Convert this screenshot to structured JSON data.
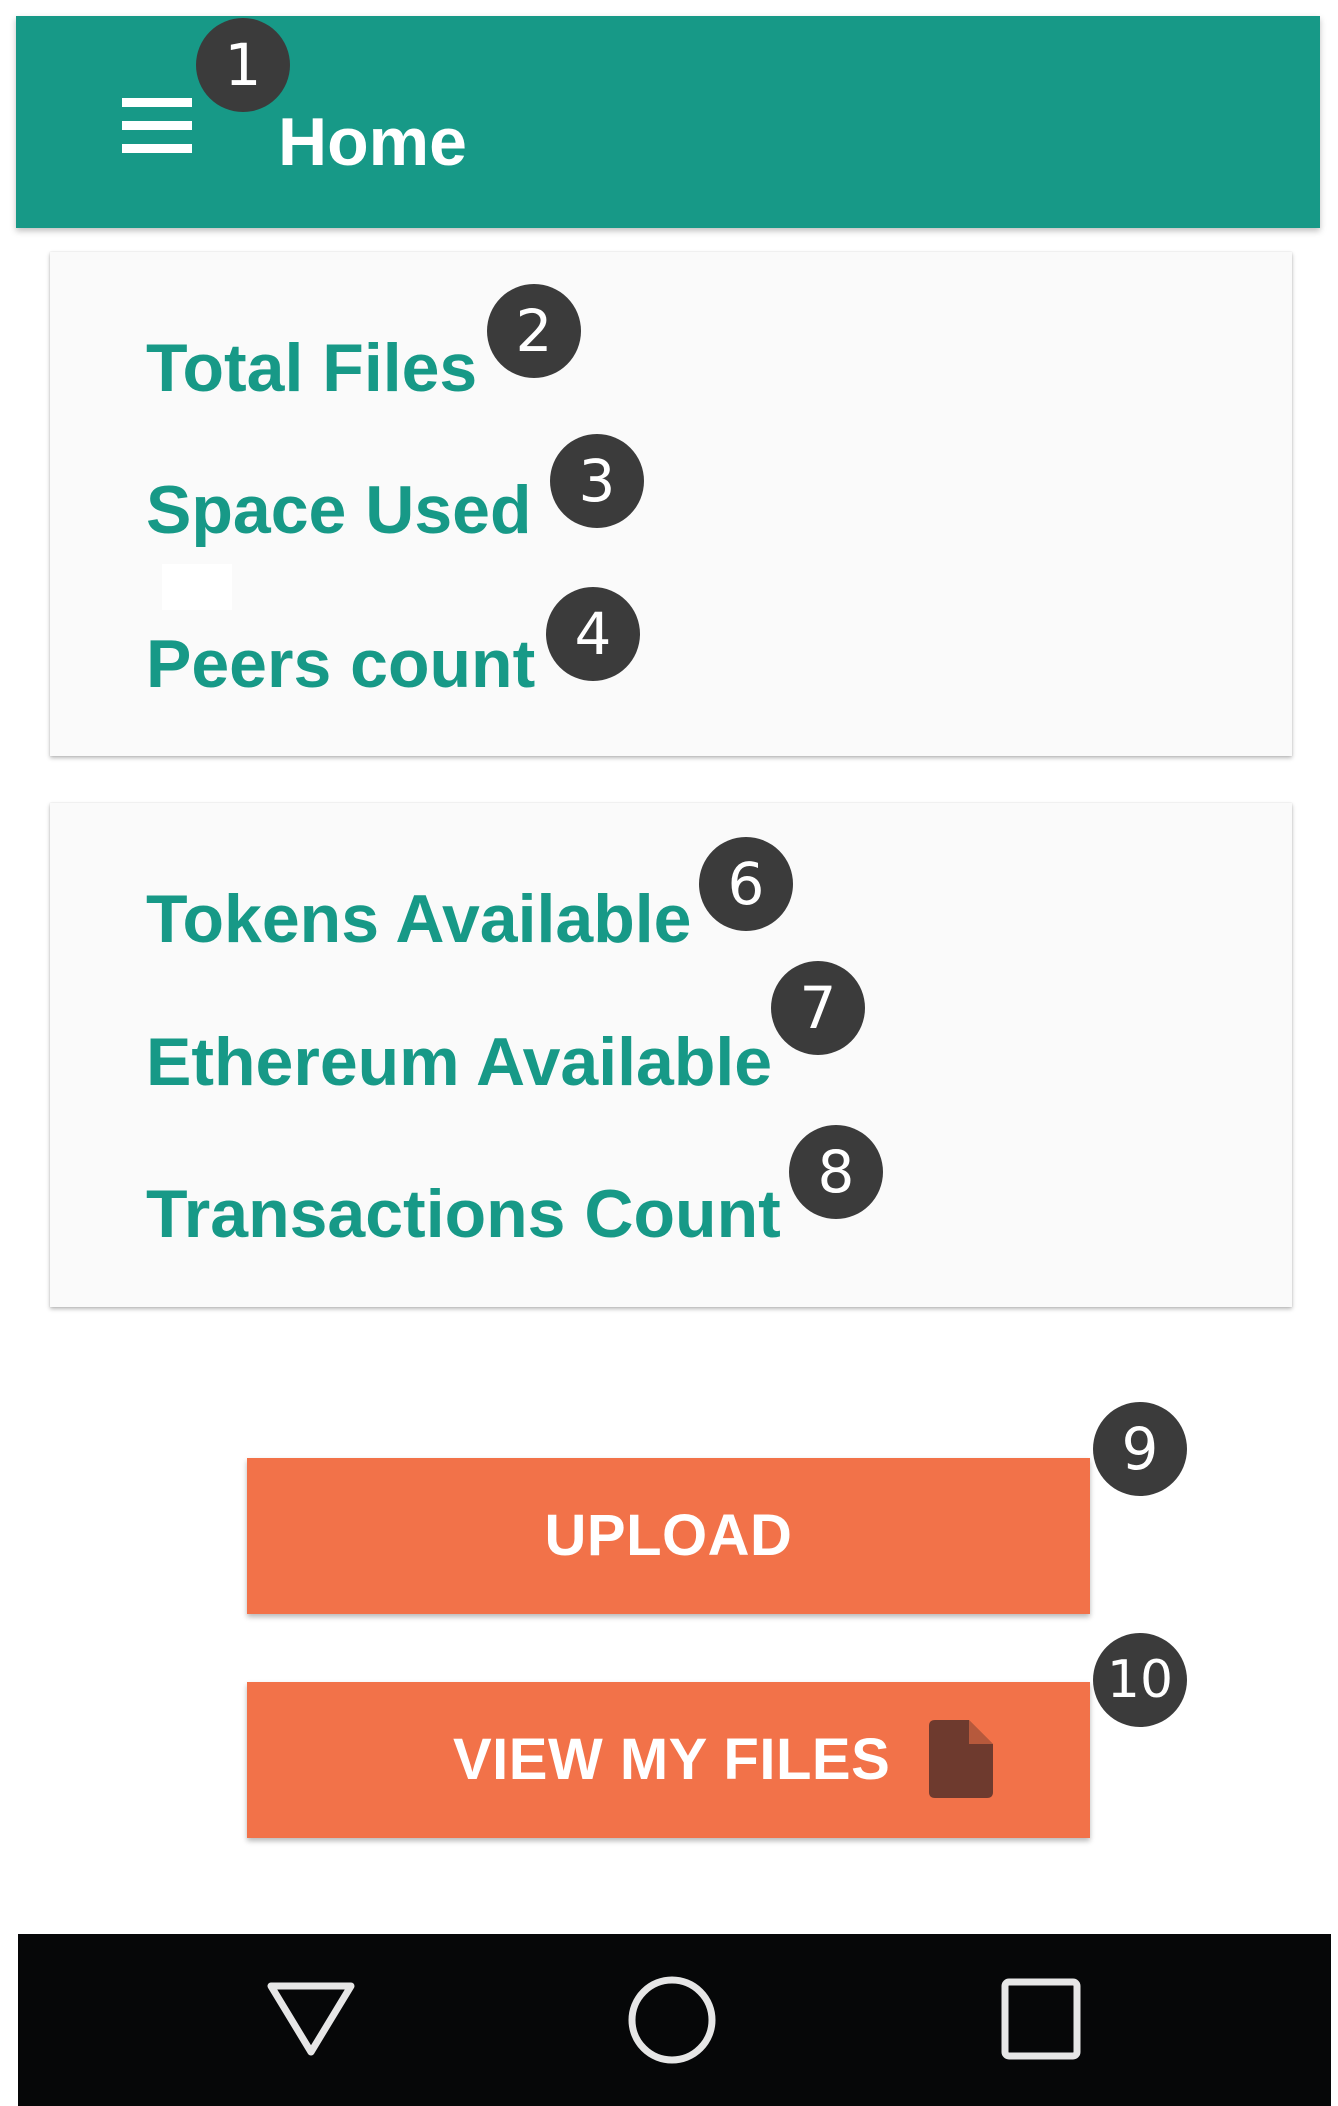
{
  "app_bar": {
    "title": "Home",
    "menu_icon": "hamburger-menu-icon",
    "color": "#179987"
  },
  "storage_card": {
    "stats": [
      "Total Files",
      "Space Used",
      "Peers count"
    ]
  },
  "wallet_card": {
    "stats": [
      "Tokens Available",
      "Ethereum Available",
      "Transactions Count"
    ]
  },
  "buttons": {
    "upload_label": "UPLOAD",
    "view_files_label": "VIEW MY FILES",
    "view_files_icon": "file-icon",
    "color": "#f27249"
  },
  "annotations": [
    "1",
    "2",
    "3",
    "4",
    "6",
    "7",
    "8",
    "9",
    "10"
  ],
  "system_nav": {
    "icons": [
      "back-triangle-icon",
      "home-circle-icon",
      "recent-apps-square-icon"
    ]
  },
  "colors": {
    "primary": "#179987",
    "accent": "#f27249",
    "card_background": "#fafafa",
    "badge": "#3b3b3b",
    "nav_bar": "#060708"
  }
}
